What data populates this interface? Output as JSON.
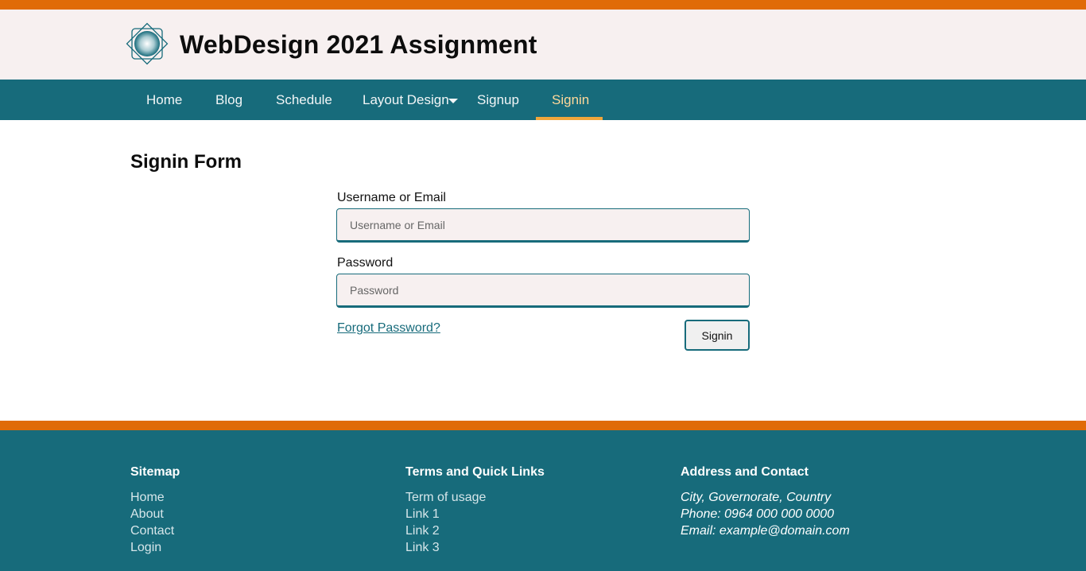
{
  "header": {
    "title": "WebDesign 2021 Assignment",
    "logo_icon": "diamond-logo-icon"
  },
  "nav": {
    "items": [
      {
        "label": "Home"
      },
      {
        "label": "Blog"
      },
      {
        "label": "Schedule"
      },
      {
        "label": "Layout Design"
      },
      {
        "label": "Signup"
      },
      {
        "label": "Signin",
        "active": true
      }
    ]
  },
  "form": {
    "title": "Signin Form",
    "username_label": "Username or Email",
    "username_placeholder": "Username or Email",
    "username_value": "",
    "password_label": "Password",
    "password_placeholder": "Password",
    "password_value": "",
    "forgot_link": "Forgot Password?",
    "submit_label": "Signin"
  },
  "footer": {
    "sitemap": {
      "heading": "Sitemap",
      "links": [
        "Home",
        "About",
        "Contact",
        "Login"
      ]
    },
    "terms": {
      "heading": "Terms and Quick Links",
      "links": [
        "Term of usage",
        "Link 1",
        "Link 2",
        "Link 3"
      ]
    },
    "contact": {
      "heading": "Address and Contact",
      "lines": [
        "City, Governorate, Country",
        "Phone: 0964 000 000 0000",
        "Email: example@domain.com"
      ]
    }
  },
  "colors": {
    "accent_orange": "#e06b07",
    "brand_teal": "#176b7b",
    "header_bg": "#f7f0f0",
    "active_nav": "#ffd89a"
  }
}
